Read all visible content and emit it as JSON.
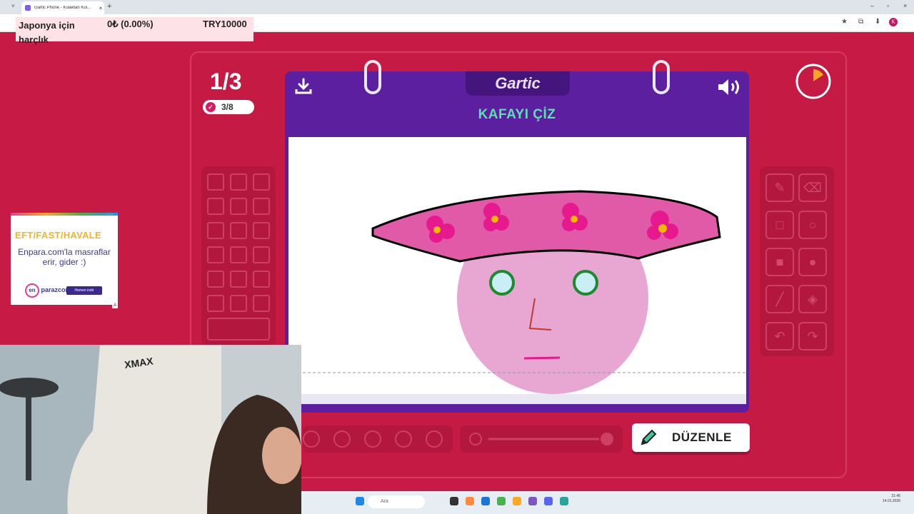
{
  "browser": {
    "tab_title": "Gartic Phone - Kulaktan Kul...",
    "tab_close": "×",
    "new_tab": "+",
    "tab_dropdown": "˅",
    "window_controls": [
      "–",
      "▫",
      "×"
    ],
    "profile_initial": "K",
    "toolbar_icons": [
      "★",
      "⧉",
      "⬇"
    ]
  },
  "overlay": {
    "label": "Japonya için harçlık",
    "percent": "0₺ (0.00%)",
    "goal": "TRY10000"
  },
  "game": {
    "round": "1/3",
    "players_done": "3/8",
    "logo": "Gartic",
    "prompt": "KAFAYI ÇİZ",
    "edit_button": "DÜZENLE",
    "timer_fraction_elapsed": 0.15
  },
  "ad": {
    "headline": "EFT/FAST/HAVALE",
    "body": "Enpara.com'la masraflar erir, gider :)",
    "brand": "en",
    "brand_text": "parazcom",
    "cta": "Hemen indir",
    "close": "ⓘ✕",
    "adchoice": "A"
  },
  "taskbar": {
    "search_placeholder": "Ara",
    "time": "21:45",
    "date": "14.01.2026"
  },
  "colors": {
    "background": "#c71b46",
    "notebook": "#5c1fa0",
    "prompt": "#5ce0b0",
    "hat": "#e05aa7",
    "face": "#e8a6d3"
  }
}
